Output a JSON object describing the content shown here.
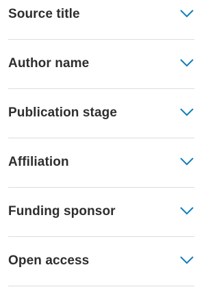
{
  "filters": [
    {
      "label": "Source title",
      "icon": "chevron-down-icon",
      "expanded": false
    },
    {
      "label": "Author name",
      "icon": "chevron-down-icon",
      "expanded": false
    },
    {
      "label": "Publication stage",
      "icon": "chevron-down-icon",
      "expanded": false
    },
    {
      "label": "Affiliation",
      "icon": "chevron-down-icon",
      "expanded": false
    },
    {
      "label": "Funding sponsor",
      "icon": "chevron-down-icon",
      "expanded": false
    },
    {
      "label": "Open access",
      "icon": "chevron-down-icon",
      "expanded": false
    }
  ],
  "colors": {
    "label": "#2e2e2e",
    "chevron": "#0c7dbb",
    "divider": "#dcdcdc"
  }
}
